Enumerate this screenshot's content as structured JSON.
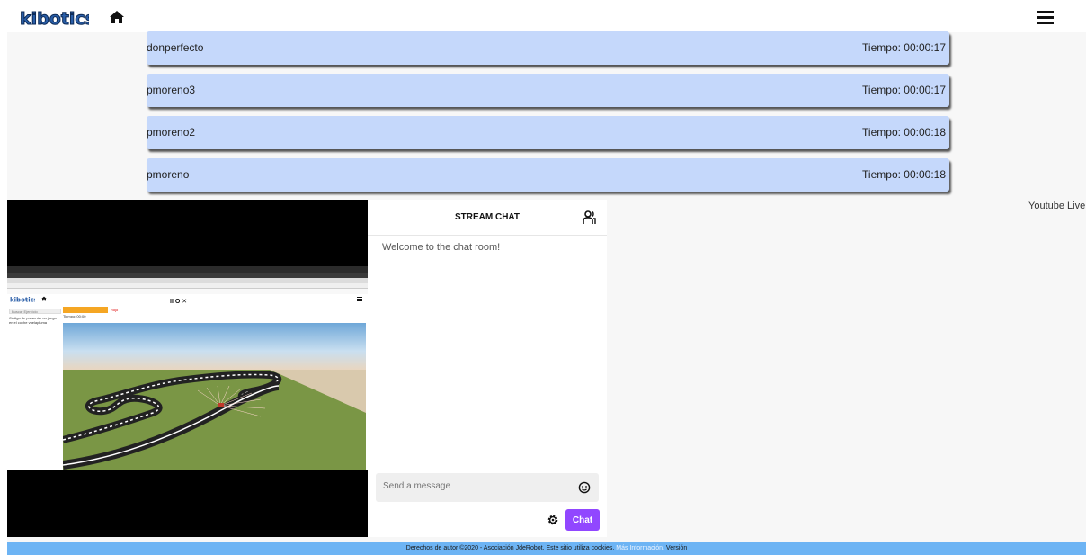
{
  "app": {
    "logo_text": "kibotics"
  },
  "ranking": [
    {
      "name": "donperfecto",
      "time": "Tiempo: 00:00:17"
    },
    {
      "name": "pmoreno3",
      "time": "Tiempo: 00:00:17"
    },
    {
      "name": "pmoreno2",
      "time": "Tiempo: 00:00:18"
    },
    {
      "name": "pmoreno",
      "time": "Tiempo: 00:00:18"
    }
  ],
  "video": {
    "inner_logo_text": "kibotics",
    "inner_controls": "II  O  ✕",
    "inner_search_placeholder": "Buscar Ejercicio",
    "inner_sidebar_text": "Código de presentar un juego en el coche vuelapluma",
    "inner_red_text": "Rojo",
    "inner_time": "Tiempo: 00:00"
  },
  "chat": {
    "title": "STREAM CHAT",
    "welcome": "Welcome to the chat room!",
    "input_placeholder": "Send a message",
    "send_label": "Chat"
  },
  "youtube_label": "Youtube Live",
  "footer": {
    "text": "Derechos de autor ©2020 - Asociación JdeRobot. Este sitio utiliza cookies.",
    "more_link": "Más Información.",
    "version_link": "Versión"
  },
  "colors": {
    "rank_bg": "#c5d8fb",
    "chat_button": "#9147ff",
    "footer_bg": "#6db4f4",
    "page_bg": "#f7f7f7"
  }
}
